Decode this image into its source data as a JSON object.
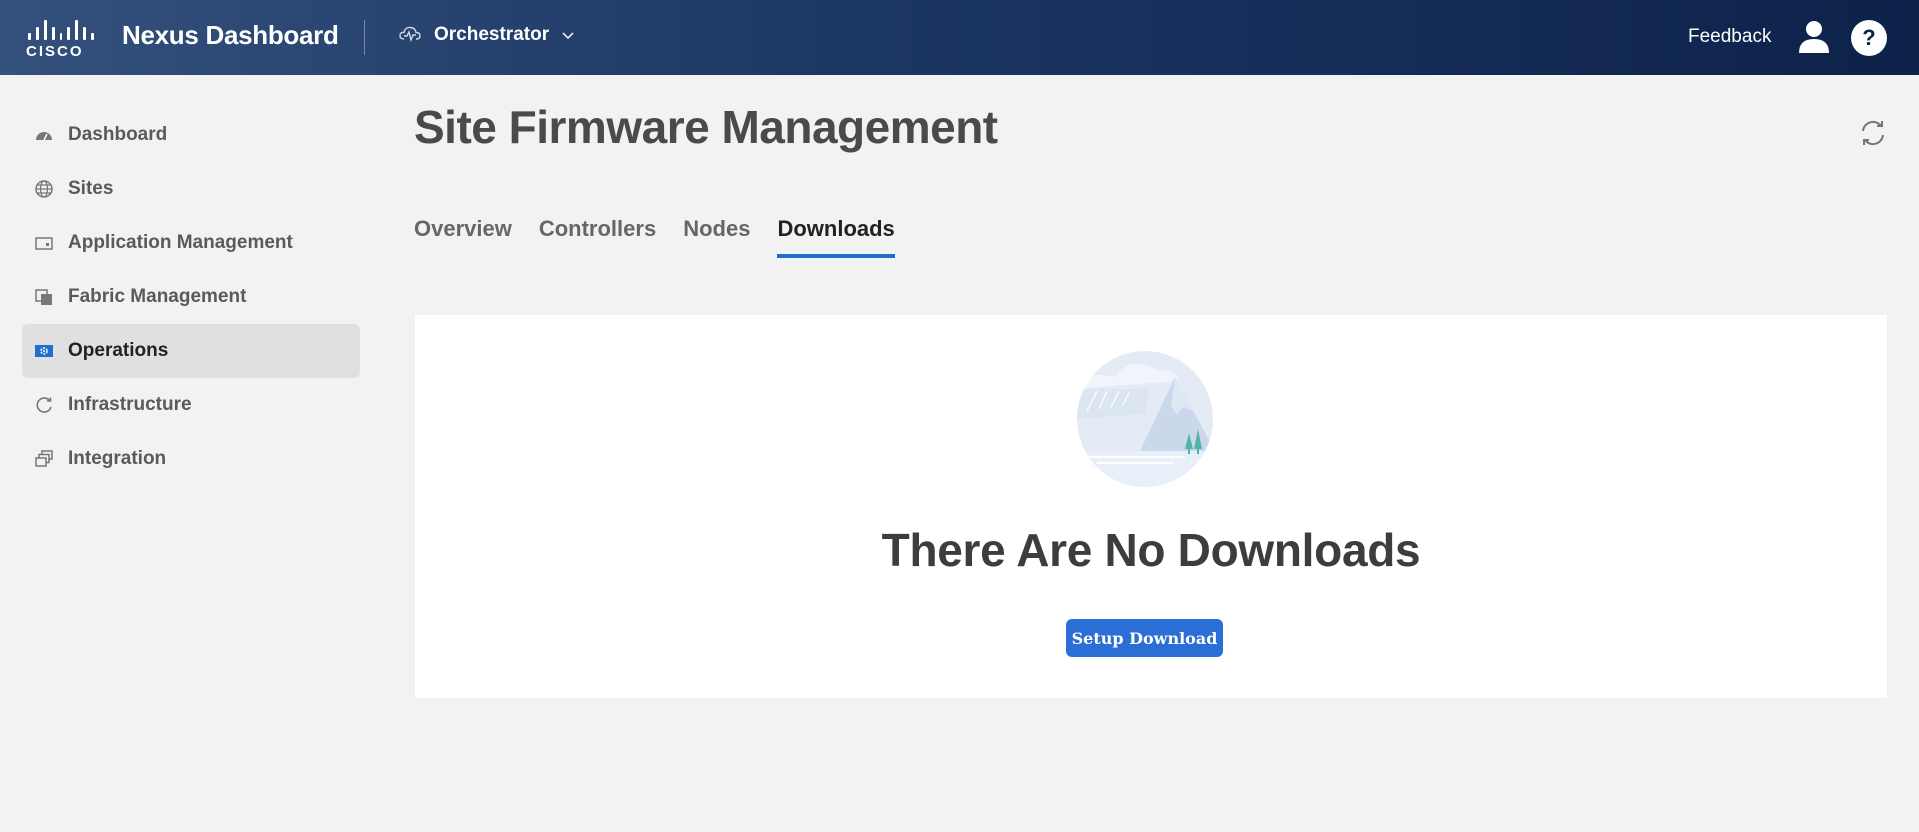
{
  "header": {
    "brand_word": "CISCO",
    "app_title": "Nexus Dashboard",
    "service_selector": "Orchestrator",
    "feedback_label": "Feedback",
    "help_label": "?"
  },
  "sidebar": {
    "items": [
      {
        "label": "Dashboard",
        "icon": "gauge-icon",
        "active": false
      },
      {
        "label": "Sites",
        "icon": "globe-icon",
        "active": false
      },
      {
        "label": "Application Management",
        "icon": "window-icon",
        "active": false
      },
      {
        "label": "Fabric Management",
        "icon": "layers-icon",
        "active": false
      },
      {
        "label": "Operations",
        "icon": "gear-box-icon",
        "active": true
      },
      {
        "label": "Infrastructure",
        "icon": "cycle-icon",
        "active": false
      },
      {
        "label": "Integration",
        "icon": "stack-icon",
        "active": false
      }
    ]
  },
  "main": {
    "page_title": "Site Firmware Management",
    "tabs": [
      {
        "label": "Overview",
        "active": false
      },
      {
        "label": "Controllers",
        "active": false
      },
      {
        "label": "Nodes",
        "active": false
      },
      {
        "label": "Downloads",
        "active": true
      }
    ],
    "empty_state": {
      "title": "There Are No Downloads",
      "button_label": "Setup Download"
    }
  },
  "colors": {
    "header_start": "#34507c",
    "header_end": "#0d2249",
    "accent": "#1e6fd0",
    "button": "#2b6fd6"
  }
}
